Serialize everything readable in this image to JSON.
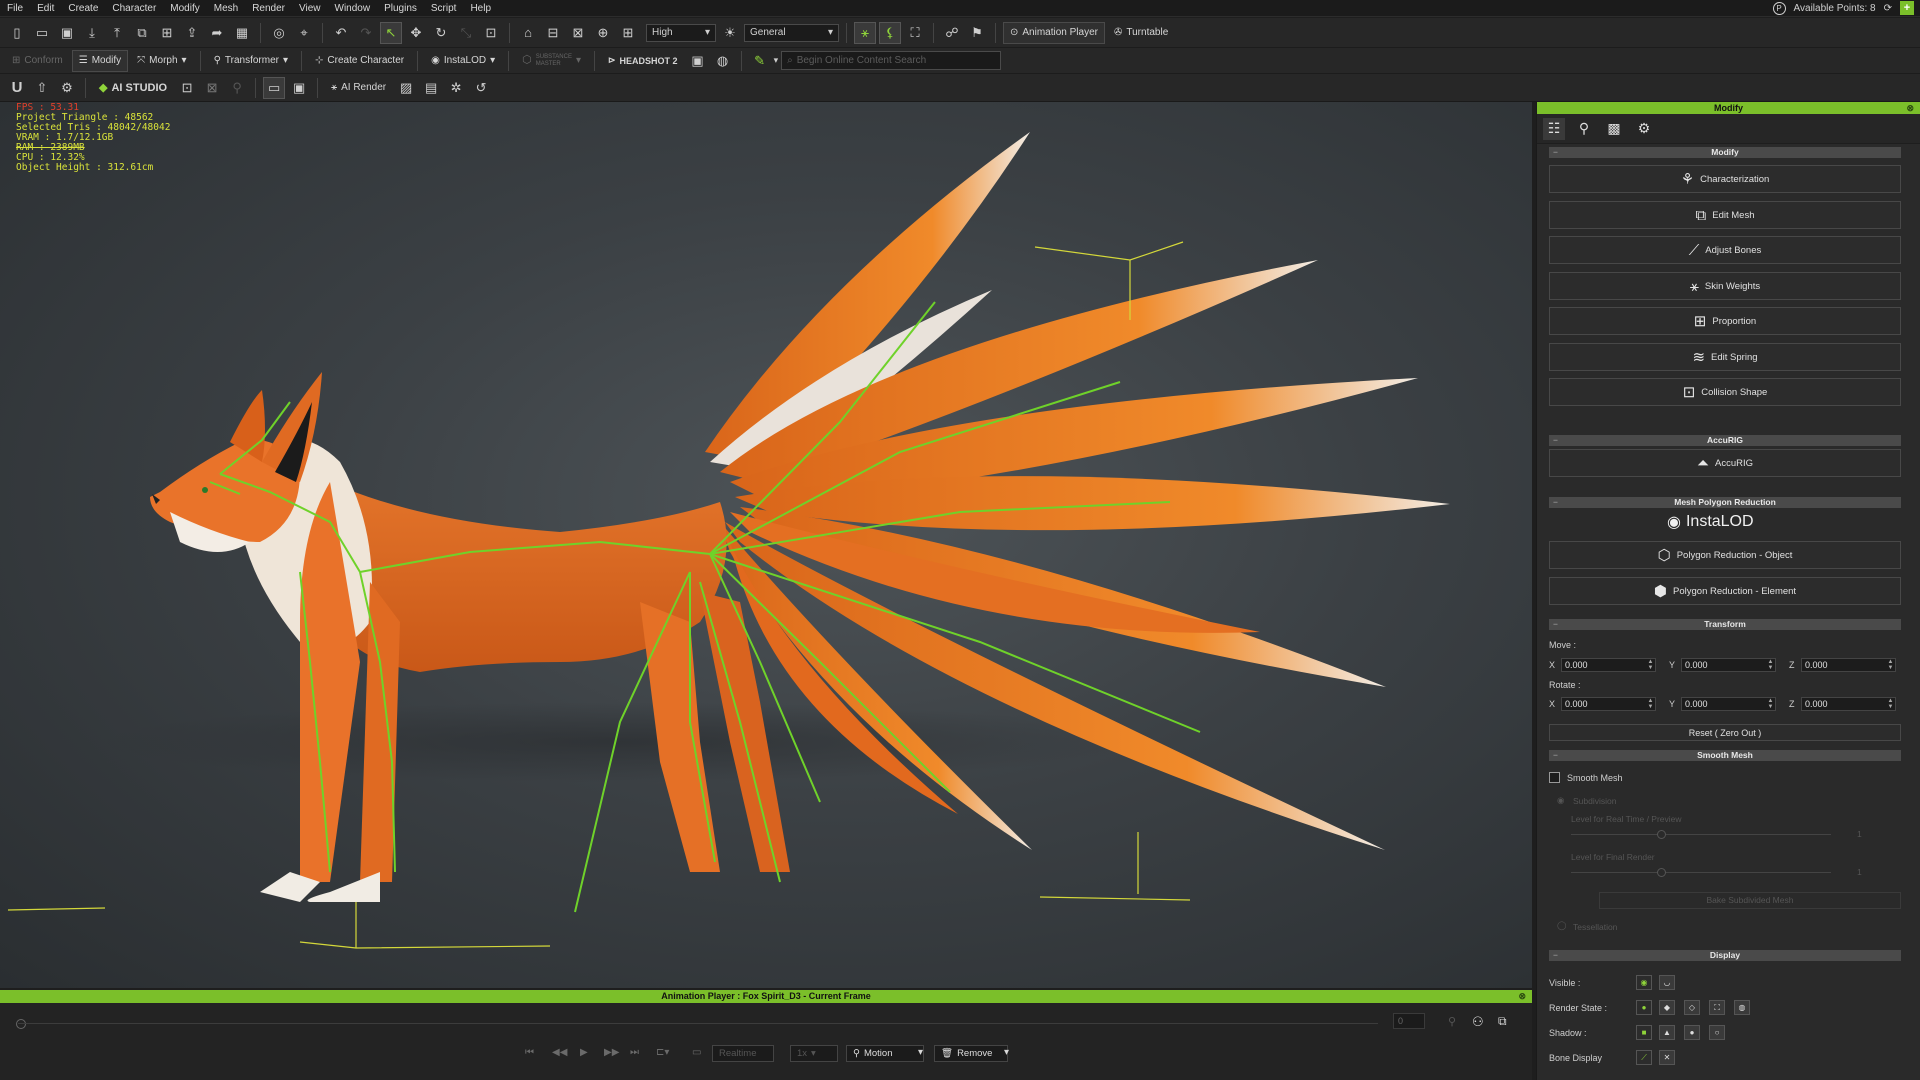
{
  "menu": [
    "File",
    "Edit",
    "Create",
    "Character",
    "Modify",
    "Mesh",
    "Render",
    "View",
    "Window",
    "Plugins",
    "Script",
    "Help"
  ],
  "menu_right": {
    "points": "Available Points: 8"
  },
  "toolbar1": {
    "quality": "High",
    "lighting": "General",
    "animation_player": "Animation Player",
    "turntable": "Turntable"
  },
  "toolbar2": {
    "conform": "Conform",
    "modify": "Modify",
    "morph": "Morph",
    "transformer": "Transformer",
    "create_character": "Create Character",
    "instalod": "InstaLOD",
    "substance_line1": "SUBSTANCE",
    "substance_line2": "MASTER",
    "headshot": "HEADSHOT 2",
    "search_placeholder": "Begin Online Content Search"
  },
  "toolbar3": {
    "ai_studio": "AI STUDIO",
    "ai_render": "AI Render"
  },
  "stats": {
    "fps": "FPS : 53.31",
    "project_triangle": "Project Triangle : 48562",
    "selected_tris": "Selected Tris : 48042/48042",
    "vram": "VRAM : 1.7/12.1GB",
    "ram": "RAM : 2389MB",
    "cpu": "CPU : 12.32%",
    "object_height": "Object Height : 312.61cm"
  },
  "panel": {
    "title": "Modify",
    "modify_header": "Modify",
    "buttons": [
      "Characterization",
      "Edit Mesh",
      "Adjust Bones",
      "Skin Weights",
      "Proportion",
      "Edit Spring",
      "Collision Shape"
    ],
    "accurig_header": "AccuRIG",
    "accurig_button": "AccuRIG",
    "mesh_poly_header": "Mesh Polygon Reduction",
    "instalod_logo": "InstaLOD",
    "poly_object": "Polygon Reduction - Object",
    "poly_element": "Polygon Reduction - Element",
    "transform_header": "Transform",
    "move_label": "Move :",
    "rotate_label": "Rotate :",
    "x": "X",
    "y": "Y",
    "z": "Z",
    "move": {
      "x": "0.000",
      "y": "0.000",
      "z": "0.000"
    },
    "rotate": {
      "x": "0.000",
      "y": "0.000",
      "z": "0.000"
    },
    "reset_button": "Reset ( Zero Out )",
    "smooth_header": "Smooth Mesh",
    "smooth_checkbox": "Smooth Mesh",
    "subdivision": "Subdivision",
    "level_preview": "Level for Real Time / Preview",
    "level_final": "Level for Final Render",
    "level_preview_value": "1",
    "level_final_value": "1",
    "bake_button": "Bake Subdivided Mesh",
    "tessellation": "Tessellation",
    "display_header": "Display",
    "visible": "Visible :",
    "render_state": "Render State :",
    "shadow": "Shadow :",
    "bone_display": "Bone Display"
  },
  "anim": {
    "title": "Animation Player : Fox Spirit_D3 - Current Frame",
    "frame": "0",
    "realtime": "Realtime",
    "speed": "1x",
    "motion": "Motion",
    "remove": "Remove"
  }
}
